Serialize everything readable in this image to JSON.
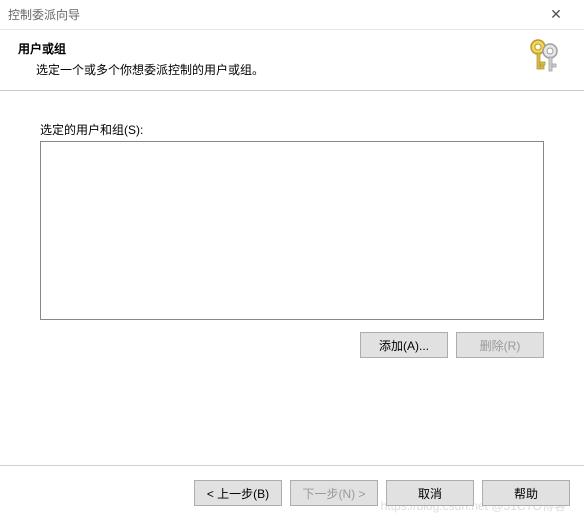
{
  "window": {
    "title": "控制委派向导",
    "close_icon": "✕"
  },
  "header": {
    "heading": "用户或组",
    "subtitle": "选定一个或多个你想委派控制的用户或组。"
  },
  "main": {
    "list_label": "选定的用户和组(S):",
    "add_button": "添加(A)...",
    "remove_button": "删除(R)"
  },
  "footer": {
    "back_button": "< 上一步(B)",
    "next_button": "下一步(N) >",
    "cancel_button": "取消",
    "help_button": "帮助"
  },
  "watermark": "https://blog.csdn.net @51CTO博客"
}
